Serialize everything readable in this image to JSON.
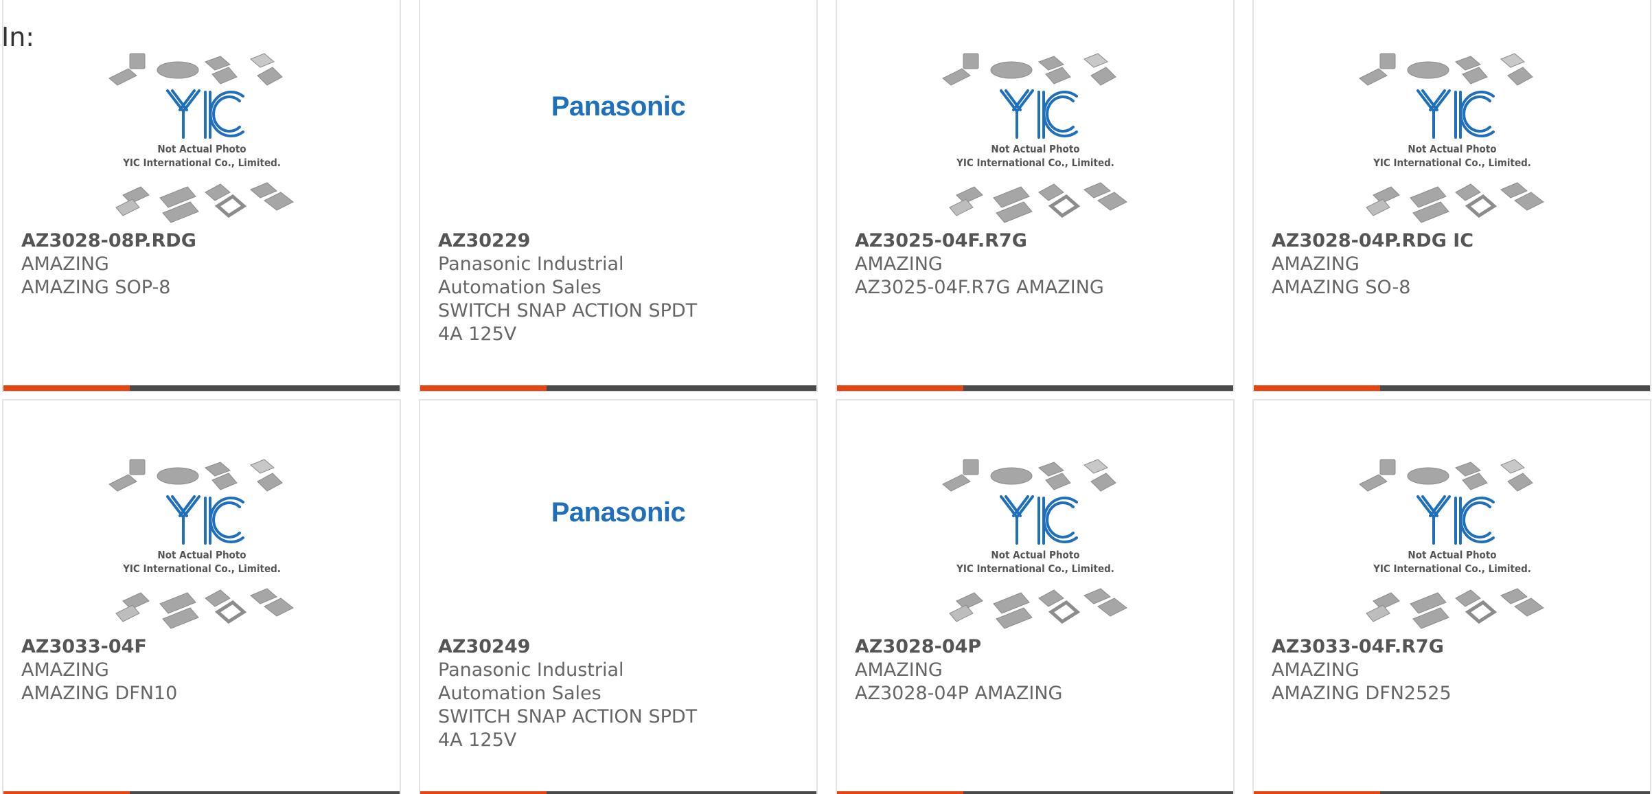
{
  "filter": {
    "label": "In:"
  },
  "colors": {
    "accent": "#e8440f",
    "bar": "#4a4a4a",
    "yic_blue": "#1f6fba",
    "chip_gray": "#a0a0a0"
  },
  "placeholder": {
    "line1": "Not Actual Photo",
    "line2": "YIC International Co., Limited.",
    "logo_text": "YIC"
  },
  "products": [
    {
      "part_no": "AZ3028-08P.RDG",
      "manufacturer": "AMAZING",
      "description": "AMAZING SOP-8",
      "image": "yic-placeholder"
    },
    {
      "part_no": "AZ30229",
      "manufacturer": "Panasonic Industrial Automation Sales",
      "description": "SWITCH SNAP ACTION SPDT 4A 125V",
      "image": "panasonic-logo",
      "brand": "Panasonic"
    },
    {
      "part_no": "AZ3025-04F.R7G",
      "manufacturer": "AMAZING",
      "description": "AZ3025-04F.R7G AMAZING",
      "image": "yic-placeholder"
    },
    {
      "part_no": "AZ3028-04P.RDG IC",
      "manufacturer": "AMAZING",
      "description": "AMAZING SO-8",
      "image": "yic-placeholder"
    },
    {
      "part_no": "AZ3033-04F",
      "manufacturer": "AMAZING",
      "description": "AMAZING DFN10",
      "image": "yic-placeholder"
    },
    {
      "part_no": "AZ30249",
      "manufacturer": "Panasonic Industrial Automation Sales",
      "description": "SWITCH SNAP ACTION SPDT 4A 125V",
      "image": "panasonic-logo",
      "brand": "Panasonic"
    },
    {
      "part_no": "AZ3028-04P",
      "manufacturer": "AMAZING",
      "description": "AZ3028-04P AMAZING",
      "image": "yic-placeholder"
    },
    {
      "part_no": "AZ3033-04F.R7G",
      "manufacturer": "AMAZING",
      "description": "AMAZING DFN2525",
      "image": "yic-placeholder"
    }
  ]
}
